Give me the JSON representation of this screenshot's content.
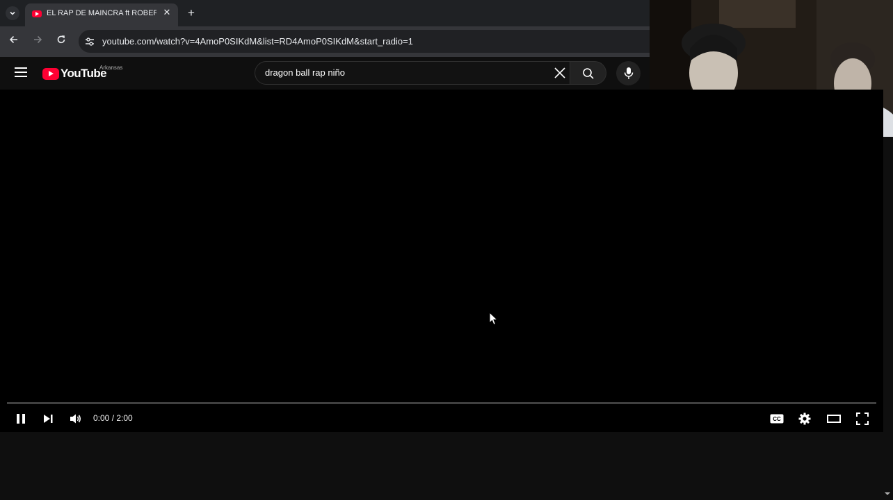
{
  "browser": {
    "tab_title": "EL RAP DE MAINCRA ft ROBERT",
    "url": "youtube.com/watch?v=4AmoP0SIKdM&list=RD4AmoP0SIKdM&start_radio=1"
  },
  "youtube": {
    "logo_text": "YouTube",
    "region": "Arkansas",
    "search_query": "dragon ball rap niño"
  },
  "player": {
    "time_display": "0:00 / 2:00",
    "progress_fraction": 0,
    "state": "playing"
  },
  "icons": {
    "tab_search": "chevron-down-icon",
    "back": "arrow-left-icon",
    "forward": "arrow-right-icon",
    "reload": "reload-icon",
    "site_info": "tune-icon",
    "menu": "hamburger-icon",
    "clear": "close-icon",
    "search": "search-icon",
    "mic": "microphone-icon",
    "pause": "pause-icon",
    "next": "next-icon",
    "volume": "volume-icon",
    "captions": "cc-icon",
    "settings": "gear-icon",
    "theater": "theater-mode-icon",
    "fullscreen": "fullscreen-icon"
  },
  "colors": {
    "brand_red": "#ff0033",
    "background": "#0f0f0f",
    "player_bg": "#000000"
  }
}
